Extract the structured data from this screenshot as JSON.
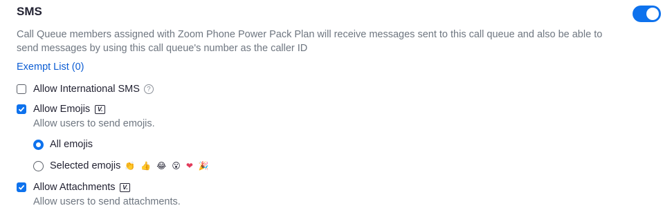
{
  "section": {
    "title": "SMS",
    "enabled": true,
    "description": "Call Queue members assigned with Zoom Phone Power Pack Plan will receive messages sent to this call queue and also be able to send messages by using this call queue's number as the caller ID",
    "exempt_link": "Exempt List (0)"
  },
  "options": {
    "international": {
      "label": "Allow International SMS",
      "checked": false,
      "help_icon": "?"
    },
    "emojis": {
      "label": "Allow Emojis",
      "checked": true,
      "badge": "V.",
      "sub": "Allow users to send emojis.",
      "choices": {
        "all": {
          "label": "All emojis",
          "selected": true
        },
        "selected": {
          "label": "Selected emojis",
          "selected": false,
          "emojis": [
            "👏",
            "👍",
            "😂",
            "😮",
            "❤",
            "🎉"
          ]
        }
      }
    },
    "attachments": {
      "label": "Allow Attachments",
      "checked": true,
      "badge": "V.",
      "sub": "Allow users to send attachments."
    }
  },
  "colors": {
    "accent": "#0e72ed",
    "link": "#0b5cd3",
    "muted": "#6e7680"
  }
}
